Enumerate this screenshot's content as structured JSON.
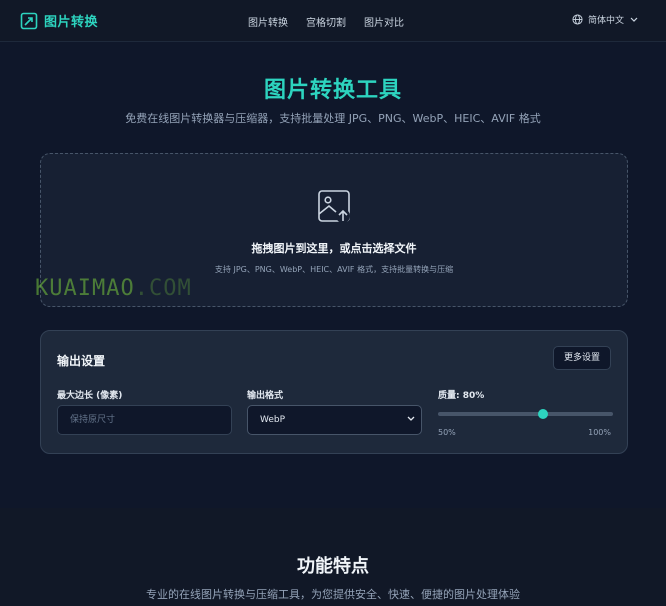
{
  "header": {
    "brand": "图片转换",
    "nav": [
      "图片转换",
      "宫格切割",
      "图片对比"
    ],
    "language": "简体中文"
  },
  "hero": {
    "title": "图片转换工具",
    "subtitle": "免费在线图片转换器与压缩器，支持批量处理 JPG、PNG、WebP、HEIC、AVIF 格式"
  },
  "dropzone": {
    "title": "拖拽图片到这里，或点击选择文件",
    "subtitle": "支持 JPG、PNG、WebP、HEIC、AVIF 格式，支持批量转换与压缩"
  },
  "watermark": {
    "text": "KUAIMAO",
    "suffix": ".COM"
  },
  "settings": {
    "title": "输出设置",
    "more_button": "更多设置",
    "max_edge": {
      "label": "最大边长 (像素)",
      "placeholder": "保持原尺寸"
    },
    "format": {
      "label": "输出格式",
      "selected": "WebP"
    },
    "quality": {
      "label": "质量: 80%",
      "value": 80,
      "min": 50,
      "max": 100,
      "min_label": "50%",
      "max_label": "100%"
    }
  },
  "features": {
    "title": "功能特点",
    "subtitle": "专业的在线图片转换与压缩工具，为您提供安全、快速、便捷的图片处理体验"
  },
  "colors": {
    "accent": "#2dd4bf",
    "background": "#0f172a",
    "card": "#1e293b"
  },
  "icons": [
    "logo-icon",
    "globe-icon",
    "chevron-down-icon",
    "image-upload-icon"
  ]
}
